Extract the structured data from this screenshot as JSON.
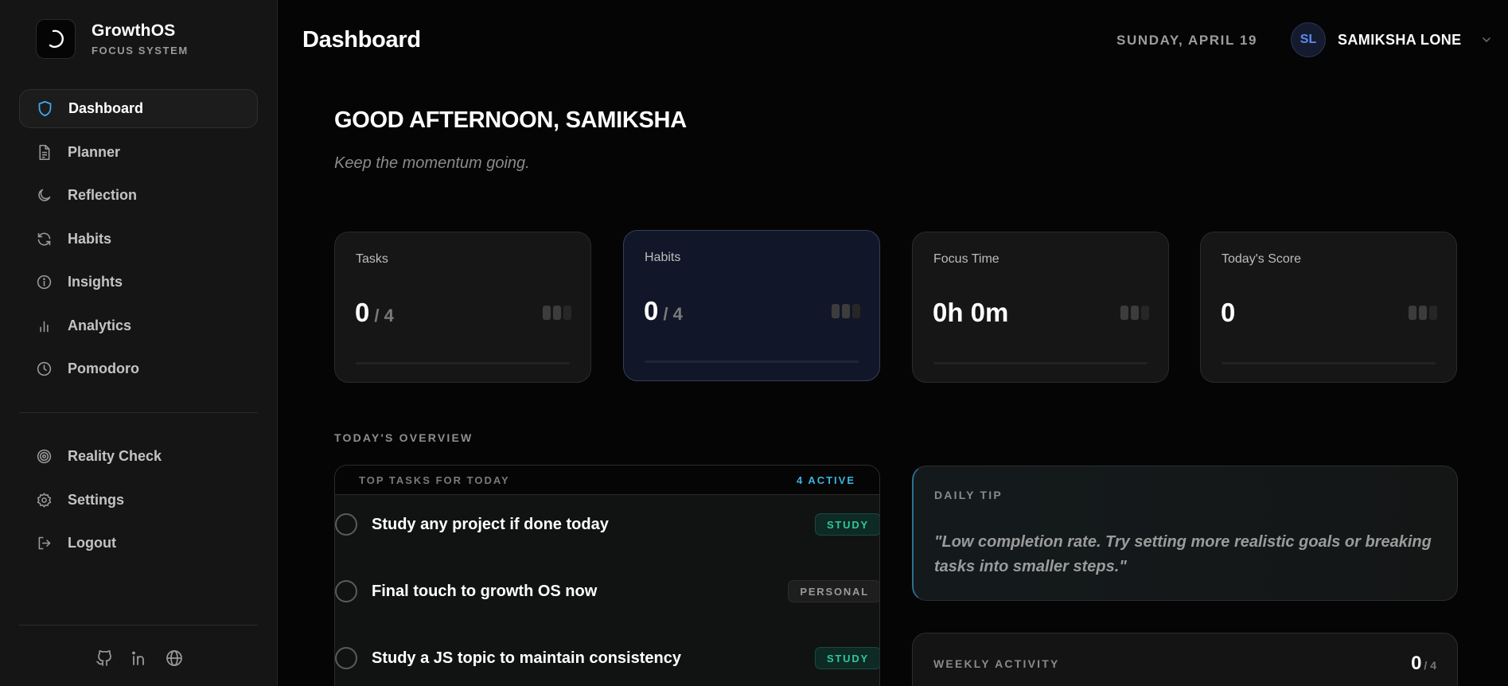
{
  "brand": {
    "name": "GrowthOS",
    "subtitle": "FOCUS SYSTEM"
  },
  "nav": {
    "items": [
      {
        "label": "Dashboard",
        "icon": "shield-icon",
        "active": true
      },
      {
        "label": "Planner",
        "icon": "document-icon"
      },
      {
        "label": "Reflection",
        "icon": "moon-icon"
      },
      {
        "label": "Habits",
        "icon": "refresh-icon"
      },
      {
        "label": "Insights",
        "icon": "info-icon"
      },
      {
        "label": "Analytics",
        "icon": "bar-chart-icon"
      },
      {
        "label": "Pomodoro",
        "icon": "clock-icon"
      }
    ],
    "secondary": [
      {
        "label": "Reality Check",
        "icon": "target-icon"
      },
      {
        "label": "Settings",
        "icon": "gear-icon"
      },
      {
        "label": "Logout",
        "icon": "logout-icon"
      }
    ],
    "socials": [
      "github-icon",
      "linkedin-icon",
      "globe-icon"
    ]
  },
  "header": {
    "title": "Dashboard",
    "date": "SUNDAY, APRIL 19",
    "user": {
      "initials": "SL",
      "name": "SAMIKSHA LONE"
    }
  },
  "greeting": {
    "title": "GOOD AFTERNOON, SAMIKSHA",
    "subtitle": "Keep the momentum going."
  },
  "stats": [
    {
      "label": "Tasks",
      "value": "0",
      "total": "/ 4"
    },
    {
      "label": "Habits",
      "value": "0",
      "total": "/ 4"
    },
    {
      "label": "Focus Time",
      "value": "0h 0m",
      "total": ""
    },
    {
      "label": "Today's Score",
      "value": "0",
      "total": ""
    }
  ],
  "overview": {
    "label": "TODAY'S OVERVIEW",
    "tasks_title": "TOP TASKS FOR TODAY",
    "tasks_active": "4 ACTIVE",
    "tasks": [
      {
        "title": "Study any project if done today",
        "tag": "STUDY"
      },
      {
        "title": "Final touch to growth OS now",
        "tag": "PERSONAL"
      },
      {
        "title": "Study a JS topic to maintain consistency",
        "tag": "STUDY"
      }
    ],
    "tip": {
      "label": "DAILY TIP",
      "text": "\"Low completion rate. Try setting more realistic goals or breaking tasks into smaller steps.\""
    },
    "weekly": {
      "label": "WEEKLY ACTIVITY",
      "value": "0",
      "total": "/ 4"
    }
  },
  "colors": {
    "accent_blue": "#39b6e0",
    "study_green": "#2fc79a",
    "avatar_blue": "#5f8bf0"
  }
}
